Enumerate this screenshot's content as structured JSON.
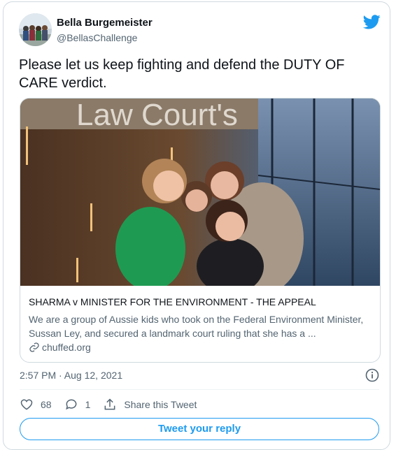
{
  "author": {
    "name": "Bella Burgemeister",
    "handle": "@BellasChallenge"
  },
  "tweet": {
    "text": "Please let us keep fighting and defend the DUTY OF CARE verdict."
  },
  "link_card": {
    "image_sign_text": "Law Court's",
    "title": "SHARMA v MINISTER FOR THE ENVIRONMENT - THE APPEAL",
    "description": "We are a group of Aussie kids who took on the Federal Environment Minister, Sussan Ley, and secured a landmark court ruling that she has a ...",
    "domain": "chuffed.org"
  },
  "meta": {
    "timestamp": "2:57 PM · Aug 12, 2021"
  },
  "actions": {
    "likes": "68",
    "replies": "1",
    "share_label": "Share this Tweet"
  },
  "reply_button": {
    "label": "Tweet your reply"
  },
  "colors": {
    "brand": "#1d9bf0",
    "secondary_text": "#536471",
    "border": "#cfd9de"
  },
  "icons": [
    "twitter-bird-icon",
    "info-icon",
    "link-icon",
    "heart-icon",
    "reply-icon",
    "share-icon"
  ]
}
